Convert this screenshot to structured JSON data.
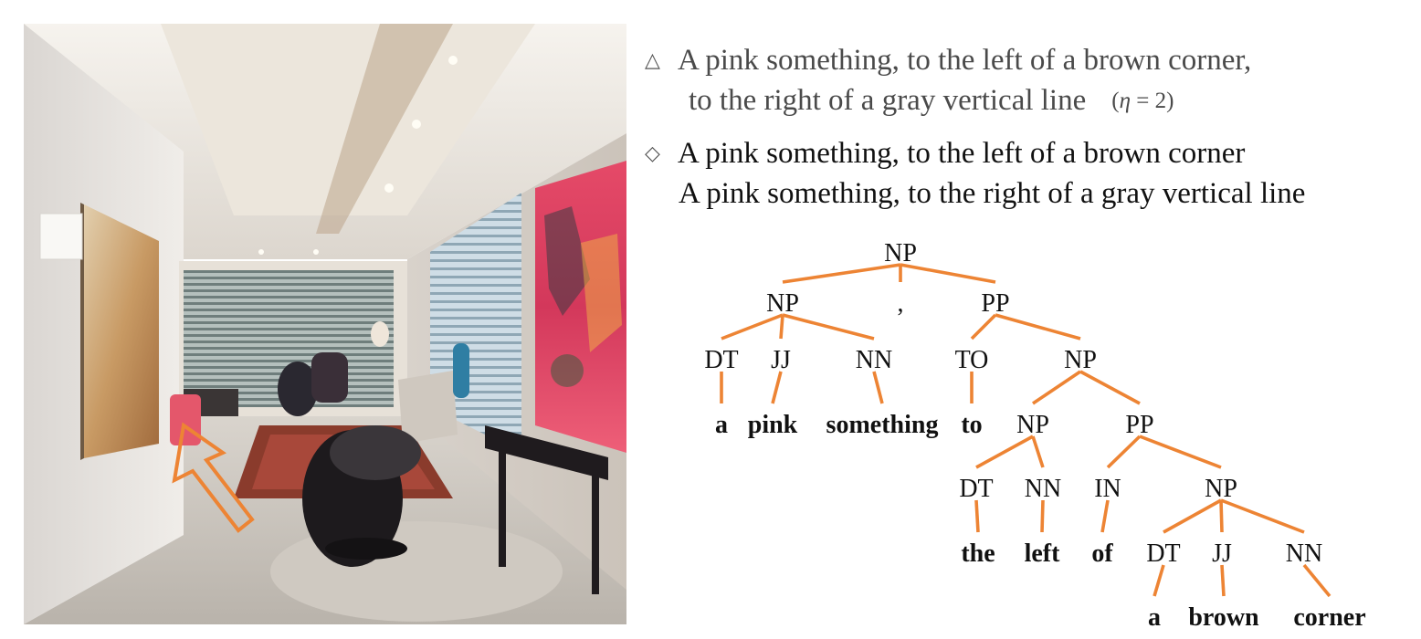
{
  "image": {
    "subject": "interior-living-room-photo",
    "arrow_color": "#ed8434",
    "arrow_pointing_at": "pink-object-left"
  },
  "captions": {
    "triangle": {
      "icon": "triangle-outline-icon",
      "line1": "A pink something, to the left of a brown corner,",
      "line2": "to the right of a gray vertical line",
      "eta_left": "(",
      "eta_symbol": "η",
      "eta_right": " = 2)"
    },
    "diamond": {
      "icon": "diamond-outline-icon",
      "line1": "A pink something, to the left of a brown corner",
      "line2": "A pink something, to the right of a gray vertical line"
    }
  },
  "colors": {
    "edge": "#ed8434",
    "text": "#111111"
  },
  "tree": {
    "nodes": [
      {
        "id": "n0",
        "label": "NP"
      },
      {
        "id": "n1",
        "label": "NP"
      },
      {
        "id": "n2",
        "label": ","
      },
      {
        "id": "n3",
        "label": "PP"
      },
      {
        "id": "n4",
        "label": "DT"
      },
      {
        "id": "n5",
        "label": "JJ"
      },
      {
        "id": "n6",
        "label": "NN"
      },
      {
        "id": "n7",
        "label": "TO"
      },
      {
        "id": "n8",
        "label": "NP"
      },
      {
        "id": "w0",
        "label": "a",
        "leaf": true
      },
      {
        "id": "w1",
        "label": "pink",
        "leaf": true
      },
      {
        "id": "w2",
        "label": "something",
        "leaf": true
      },
      {
        "id": "w3",
        "label": "to",
        "leaf": true
      },
      {
        "id": "n9",
        "label": "NP"
      },
      {
        "id": "n10",
        "label": "PP"
      },
      {
        "id": "n11",
        "label": "DT"
      },
      {
        "id": "n12",
        "label": "NN"
      },
      {
        "id": "n13",
        "label": "IN"
      },
      {
        "id": "n14",
        "label": "NP"
      },
      {
        "id": "w4",
        "label": "the",
        "leaf": true
      },
      {
        "id": "w5",
        "label": "left",
        "leaf": true
      },
      {
        "id": "w6",
        "label": "of",
        "leaf": true
      },
      {
        "id": "n15",
        "label": "DT"
      },
      {
        "id": "n16",
        "label": "JJ"
      },
      {
        "id": "n17",
        "label": "NN"
      },
      {
        "id": "w7",
        "label": "a",
        "leaf": true
      },
      {
        "id": "w8",
        "label": "brown",
        "leaf": true
      },
      {
        "id": "w9",
        "label": "corner",
        "leaf": true
      }
    ],
    "edges": [
      [
        "n0",
        "n1"
      ],
      [
        "n0",
        "n2"
      ],
      [
        "n0",
        "n3"
      ],
      [
        "n1",
        "n4"
      ],
      [
        "n1",
        "n5"
      ],
      [
        "n1",
        "n6"
      ],
      [
        "n3",
        "n7"
      ],
      [
        "n3",
        "n8"
      ],
      [
        "n4",
        "w0"
      ],
      [
        "n5",
        "w1"
      ],
      [
        "n6",
        "w2"
      ],
      [
        "n7",
        "w3"
      ],
      [
        "n8",
        "n9"
      ],
      [
        "n8",
        "n10"
      ],
      [
        "n9",
        "n11"
      ],
      [
        "n9",
        "n12"
      ],
      [
        "n10",
        "n13"
      ],
      [
        "n10",
        "n14"
      ],
      [
        "n11",
        "w4"
      ],
      [
        "n12",
        "w5"
      ],
      [
        "n13",
        "w6"
      ],
      [
        "n14",
        "n15"
      ],
      [
        "n14",
        "n16"
      ],
      [
        "n14",
        "n17"
      ],
      [
        "n15",
        "w7"
      ],
      [
        "n16",
        "w8"
      ],
      [
        "n17",
        "w9"
      ]
    ]
  }
}
